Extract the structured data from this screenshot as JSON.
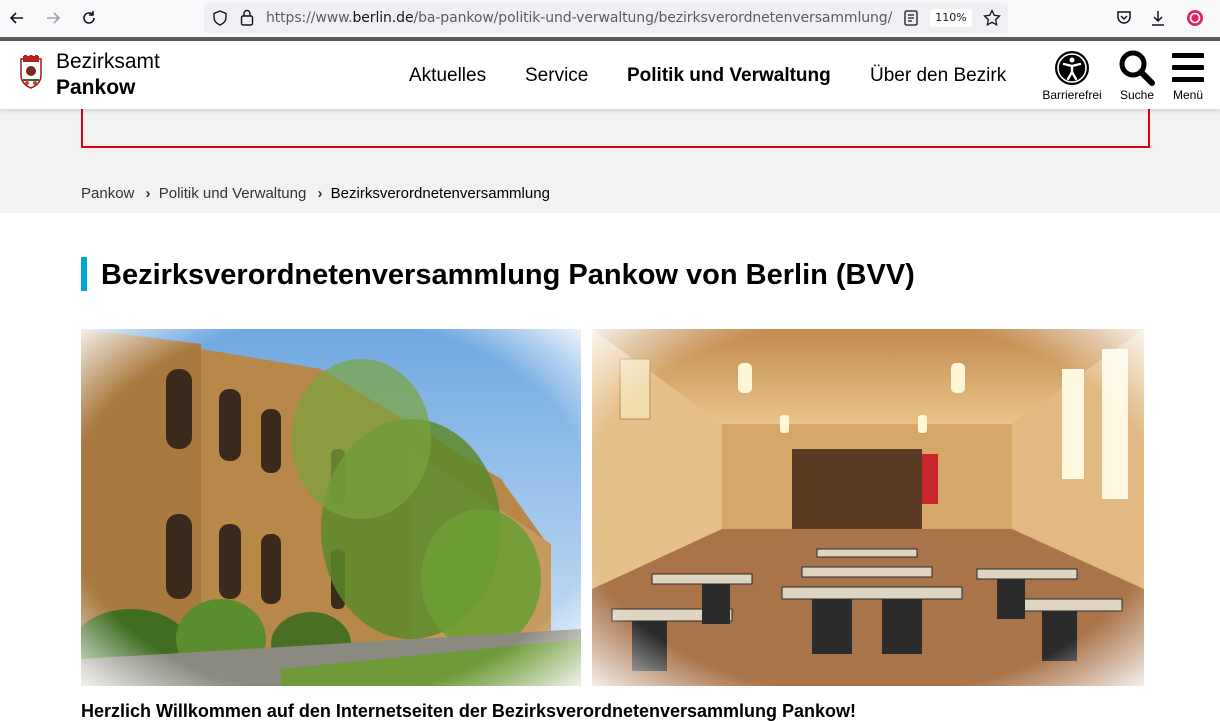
{
  "browser": {
    "url_prefix": "https://www.",
    "url_domain": "berlin.de",
    "url_path": "/ba-pankow/politik-und-verwaltung/bezirksverordnetenversammlung/",
    "zoom": "110%"
  },
  "site": {
    "brand_line1": "Bezirksamt",
    "brand_line2": "Pankow",
    "nav": [
      "Aktuelles",
      "Service",
      "Politik und Verwaltung",
      "Über den Bezirk"
    ],
    "tools": {
      "accessibility": "Barrierefrei",
      "search": "Suche",
      "menu": "Menü"
    }
  },
  "breadcrumb": [
    "Pankow",
    "Politik und Verwaltung",
    "Bezirksverordnetenversammlung"
  ],
  "page": {
    "title": "Bezirksverordnetenversammlung Pankow von Berlin (BVV)",
    "welcome": "Herzlich Willkommen auf den Internetseiten der Bezirksverordnetenversammlung Pankow!"
  },
  "colors": {
    "accent": "#00a6d6",
    "alert_border": "#e3000f",
    "band": "#f2f2f2"
  }
}
